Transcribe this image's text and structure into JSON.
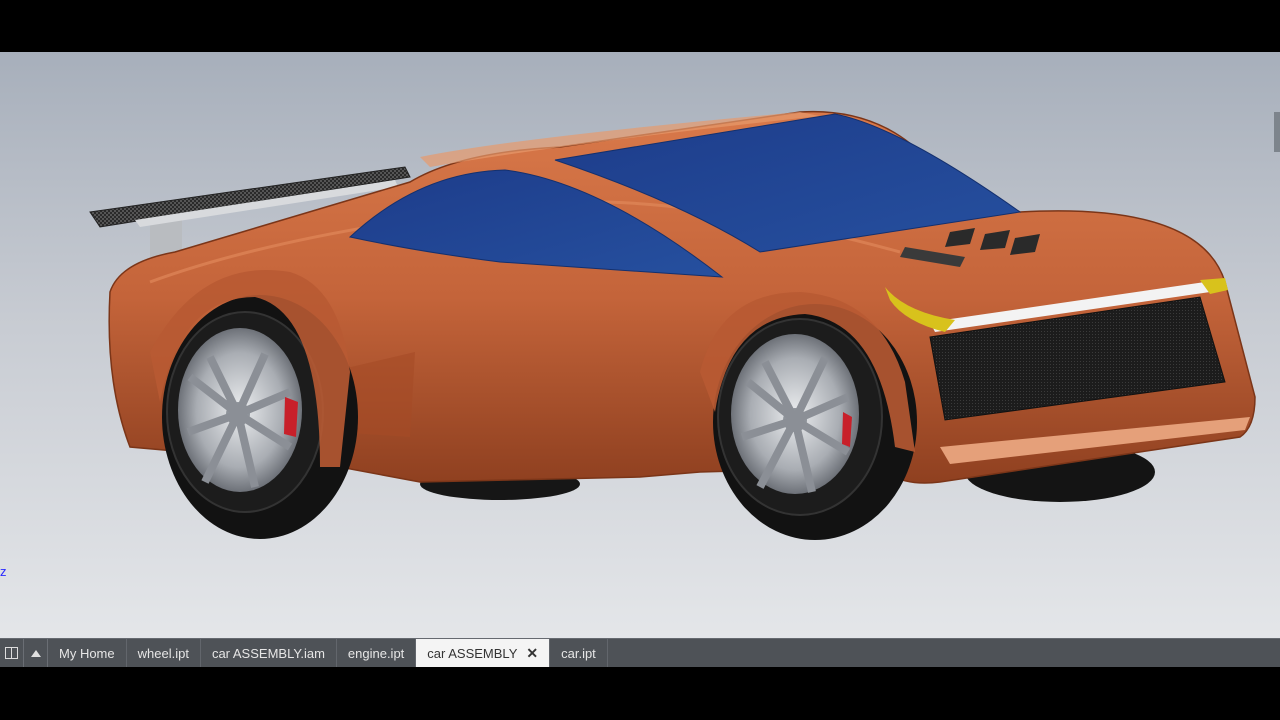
{
  "viewport": {
    "model_name": "car-assembly-3d-model",
    "axis_indicator": "z",
    "colors": {
      "body": "#c4643a",
      "body_dark": "#8f4020",
      "glass": "#1e3f8f",
      "tire": "#1a1a1a",
      "rim": "#b5b8bd",
      "background_top": "#a7afbb",
      "background_bottom": "#e4e6e9"
    }
  },
  "tabbar": {
    "tile_icon": "tile-windows-icon",
    "up_icon": "triangle-up-icon",
    "tabs": [
      {
        "label": "My Home",
        "active": false
      },
      {
        "label": "wheel.ipt",
        "active": false
      },
      {
        "label": "car ASSEMBLY.iam",
        "active": false
      },
      {
        "label": "engine.ipt",
        "active": false
      },
      {
        "label": "car ASSEMBLY",
        "active": true,
        "close_icon": "close-icon"
      },
      {
        "label": "car.ipt",
        "active": false
      }
    ],
    "close_glyph": "✕"
  }
}
